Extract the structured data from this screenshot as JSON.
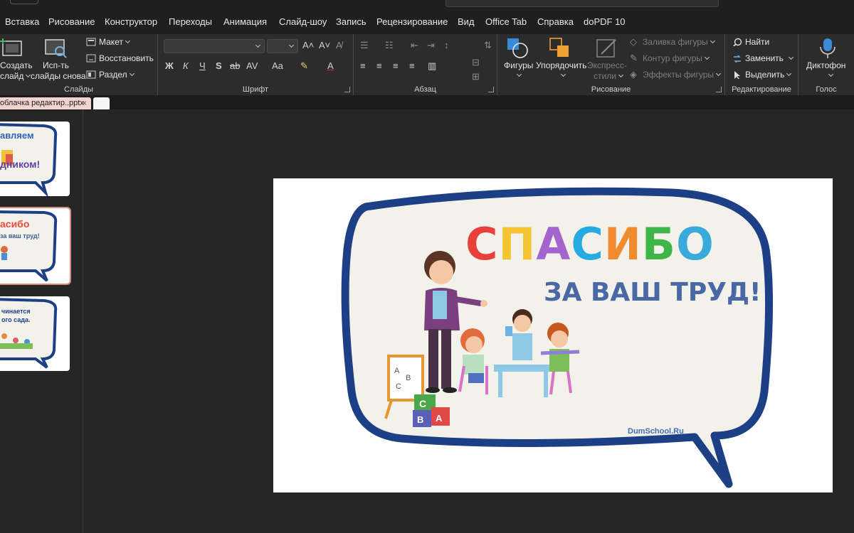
{
  "menu_tabs": [
    "Вставка",
    "Рисование",
    "Конструктор",
    "Переходы",
    "Анимация",
    "Слайд-шоу",
    "Запись",
    "Рецензирование",
    "Вид",
    "Office Tab",
    "Справка",
    "doPDF 10"
  ],
  "ribbon": {
    "slides": {
      "label": "Слайды",
      "create_line1": "Создать",
      "create_line2": "слайд",
      "reuse_line1": "Исп-ть",
      "reuse_line2": "слайды снова",
      "layout": "Макет",
      "reset": "Восстановить",
      "section": "Раздел"
    },
    "font": {
      "label": "Шрифт"
    },
    "paragraph": {
      "label": "Абзац"
    },
    "drawing": {
      "label": "Рисование",
      "shapes": "Фигуры",
      "arrange": "Упорядочить",
      "quick_styles_line1": "Экспресс-",
      "quick_styles_line2": "стили",
      "fill": "Заливка фигуры",
      "outline": "Контур фигуры",
      "effects": "Эффекты фигуры"
    },
    "editing": {
      "label": "Редактирование",
      "find": "Найти",
      "replace": "Заменить",
      "select": "Выделить"
    },
    "voice": {
      "label": "Голос",
      "dictate": "Диктофон"
    }
  },
  "document_tab": {
    "title": "облачка редактир..pptx",
    "close": "×"
  },
  "thumbnails": [
    {
      "text1": "авляем",
      "text2": "дником!"
    },
    {
      "text1": "асибо",
      "text2": "за ваш труд!"
    },
    {
      "text1": "чинается",
      "text2": "ого сада."
    }
  ],
  "slide": {
    "title_letters": [
      "С",
      "П",
      "А",
      "С",
      "И",
      "Б",
      "О"
    ],
    "title_colors": [
      "#e8413c",
      "#f4c431",
      "#a563cf",
      "#27a9e1",
      "#f08b2e",
      "#3fb449",
      "#3aa9dc"
    ],
    "subtitle": "ЗА ВАШ ТРУД!",
    "watermark": "DumSchool.Ru"
  },
  "icons": [
    "new-slide-icon",
    "reuse-slides-icon",
    "layout-icon",
    "reset-icon",
    "section-icon",
    "shapes-icon",
    "arrange-icon",
    "quick-styles-icon",
    "find-icon",
    "replace-icon",
    "select-icon",
    "microphone-icon"
  ]
}
